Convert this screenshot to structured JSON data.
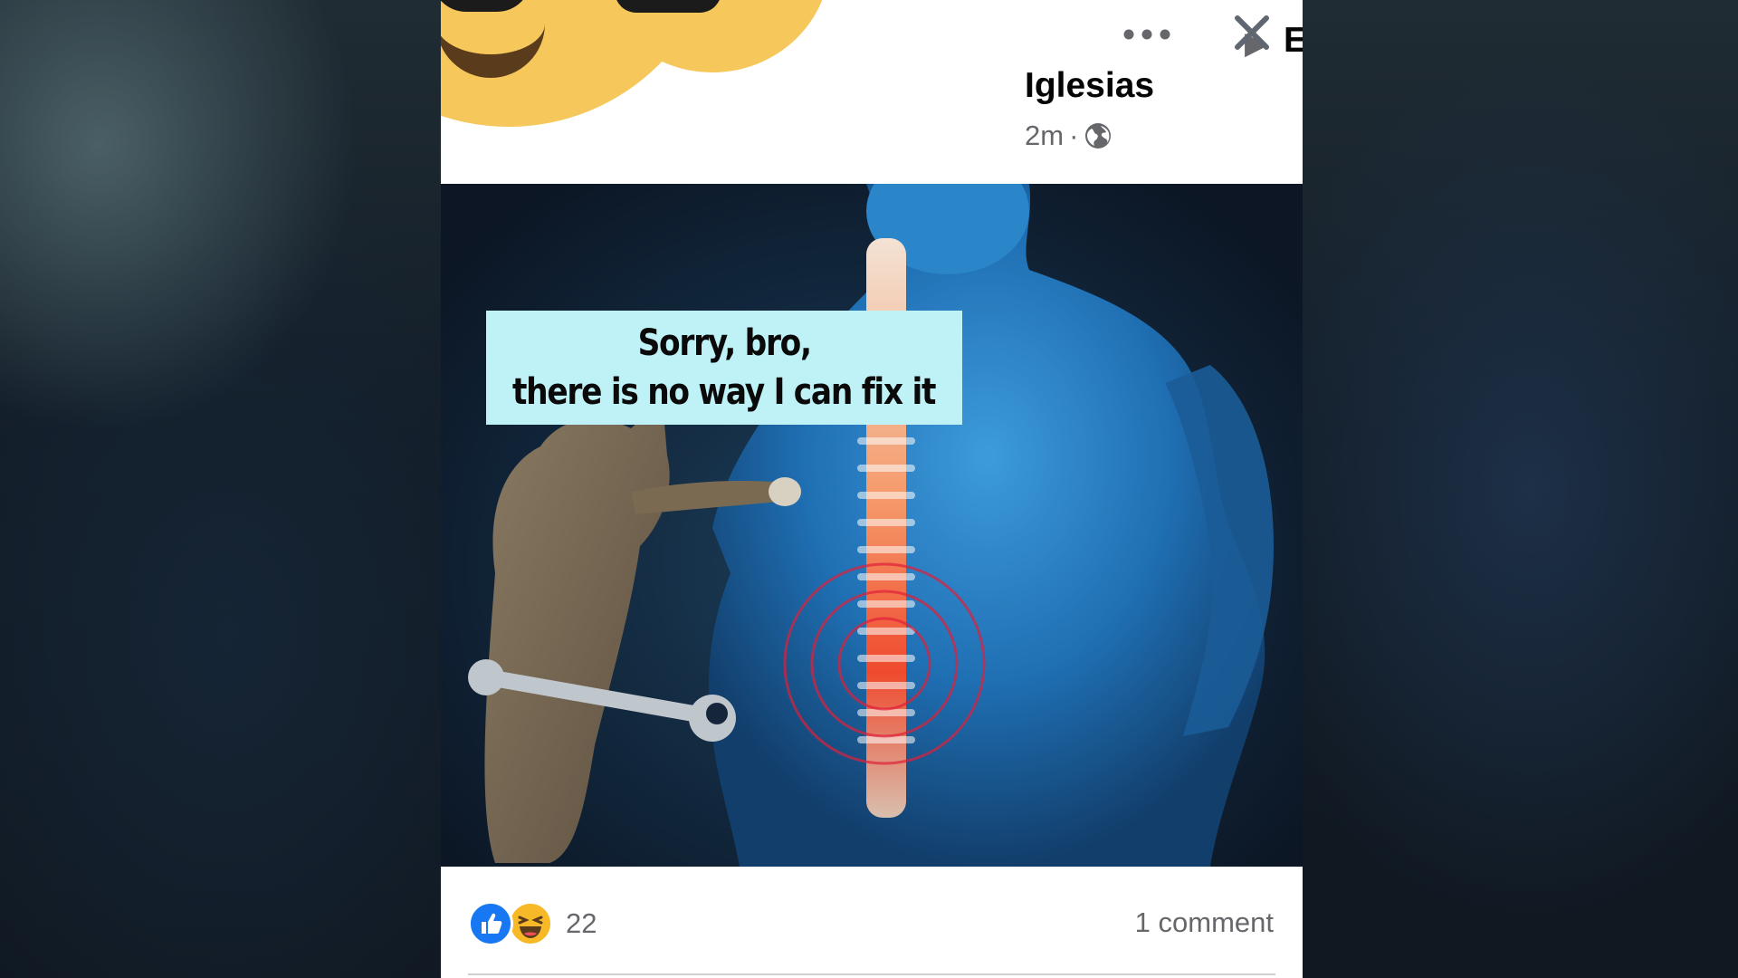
{
  "post": {
    "author_name_line1": "Enrique",
    "author_name_line2": "Iglesias",
    "time": "2m",
    "separator": "·",
    "audience_icon": "globe-icon",
    "more_icon": "more-options-icon",
    "close_icon": "close-icon"
  },
  "image": {
    "caption_line1": "Sorry, bro,",
    "caption_line2": "there is no way I can fix it"
  },
  "footer": {
    "reaction_icons": [
      "like-icon",
      "haha-icon"
    ],
    "reaction_count": "22",
    "comments_label": "1 comment"
  },
  "colors": {
    "like_blue": "#1877f2",
    "haha_yellow": "#f7b928",
    "caption_bg": "#bff2f7",
    "secondary_text": "#65676b"
  }
}
